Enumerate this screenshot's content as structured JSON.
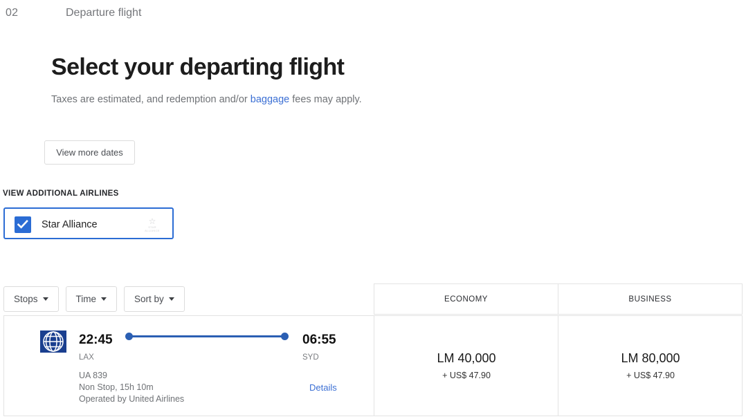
{
  "step": {
    "number": "02",
    "label": "Departure flight"
  },
  "heading": {
    "title": "Select your departing flight",
    "subtitle_before": "Taxes are estimated, and redemption and/or ",
    "subtitle_link": "baggage",
    "subtitle_after": " fees may apply."
  },
  "actions": {
    "view_more_dates": "View more dates"
  },
  "additional_airlines": {
    "label": "VIEW ADDITIONAL AIRLINES",
    "option": {
      "name": "Star Alliance",
      "checked": true,
      "logo_text": "STAR ALLIANCE",
      "logo_icon": "star-icon"
    }
  },
  "filters": [
    {
      "label": "Stops",
      "icon": "chevron-down-icon"
    },
    {
      "label": "Time",
      "icon": "chevron-down-icon"
    },
    {
      "label": "Sort by",
      "icon": "chevron-down-icon"
    }
  ],
  "fare_columns": [
    {
      "id": "economy",
      "header": "ECONOMY"
    },
    {
      "id": "business",
      "header": "BUSINESS"
    }
  ],
  "flights": [
    {
      "airline_logo": "united-airlines-logo",
      "departure_time": "22:45",
      "departure_airport": "LAX",
      "arrival_time": "06:55",
      "arrival_airport": "SYD",
      "flight_number": "UA 839",
      "stops_duration": "Non Stop, 15h 10m",
      "operated_by": "Operated by United Airlines",
      "details_label": "Details",
      "fares": [
        {
          "miles": "LM 40,000",
          "taxes": "+ US$ 47.90"
        },
        {
          "miles": "LM 80,000",
          "taxes": "+ US$ 47.90"
        }
      ]
    }
  ],
  "colors": {
    "accent": "#2b6cd4",
    "link": "#3b6fd4",
    "line": "#2b5fb3",
    "logo_bg": "#1a3f8f"
  }
}
